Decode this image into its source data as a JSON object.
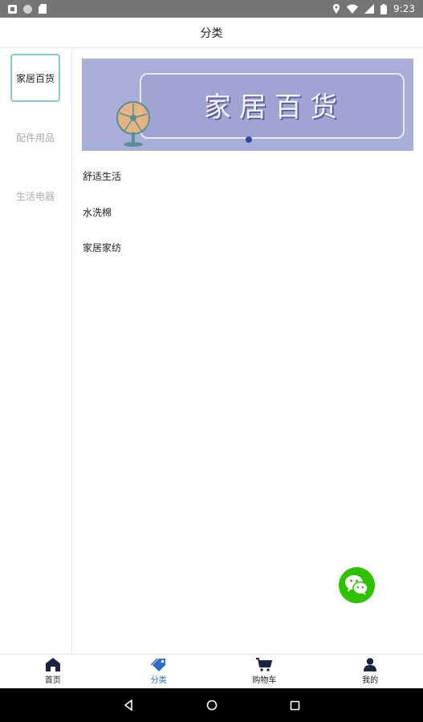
{
  "status_bar": {
    "time": "9:23"
  },
  "header": {
    "title": "分类"
  },
  "sidebar": {
    "items": [
      {
        "label": "家居百货",
        "active": true
      },
      {
        "label": "配件用品",
        "active": false
      },
      {
        "label": "生活电器",
        "active": false
      }
    ]
  },
  "banner": {
    "title": "家居百货"
  },
  "subcategories": [
    {
      "label": "舒适生活"
    },
    {
      "label": "水洗棉"
    },
    {
      "label": "家居家纺"
    }
  ],
  "tabbar": {
    "items": [
      {
        "label": "首页",
        "icon": "home-icon",
        "active": false
      },
      {
        "label": "分类",
        "icon": "tag-icon",
        "active": true
      },
      {
        "label": "购物车",
        "icon": "cart-icon",
        "active": false
      },
      {
        "label": "我的",
        "icon": "user-icon",
        "active": false
      }
    ]
  },
  "colors": {
    "active_tab": "#2b6dc8",
    "sidebar_active_border": "#7fd3c6",
    "wechat_green": "#2dc100",
    "banner_bg": "#a9aed9"
  }
}
